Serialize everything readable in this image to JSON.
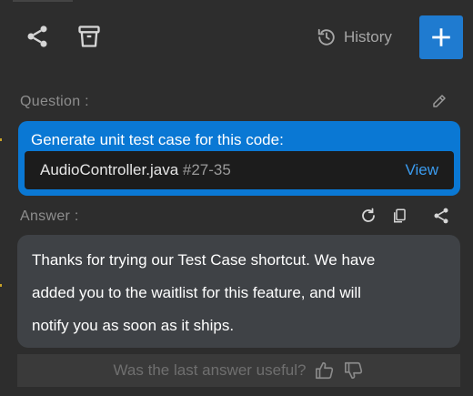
{
  "toolbar": {
    "share_icon": "share-icon",
    "trash_icon": "trash-icon",
    "history_label": "History",
    "history_icon": "history-icon",
    "new_icon": "plus-icon"
  },
  "question": {
    "label": "Question :",
    "text": "Generate unit test case for this code:",
    "file": "AudioController.java",
    "range": "#27-35",
    "view_label": "View"
  },
  "answer": {
    "label": "Answer :",
    "lines": [
      "Thanks for trying our Test Case shortcut.  We have",
      "added you to the waitlist for this feature, and will",
      "notify you as soon as it ships."
    ]
  },
  "feedback": {
    "prompt": "Was the last answer useful?"
  },
  "colors": {
    "background": "#2d2d2d",
    "accent": "#1f7bd0",
    "question_bg": "#0a78d4",
    "answer_bg": "#3f4246",
    "link": "#3b9cf0"
  }
}
